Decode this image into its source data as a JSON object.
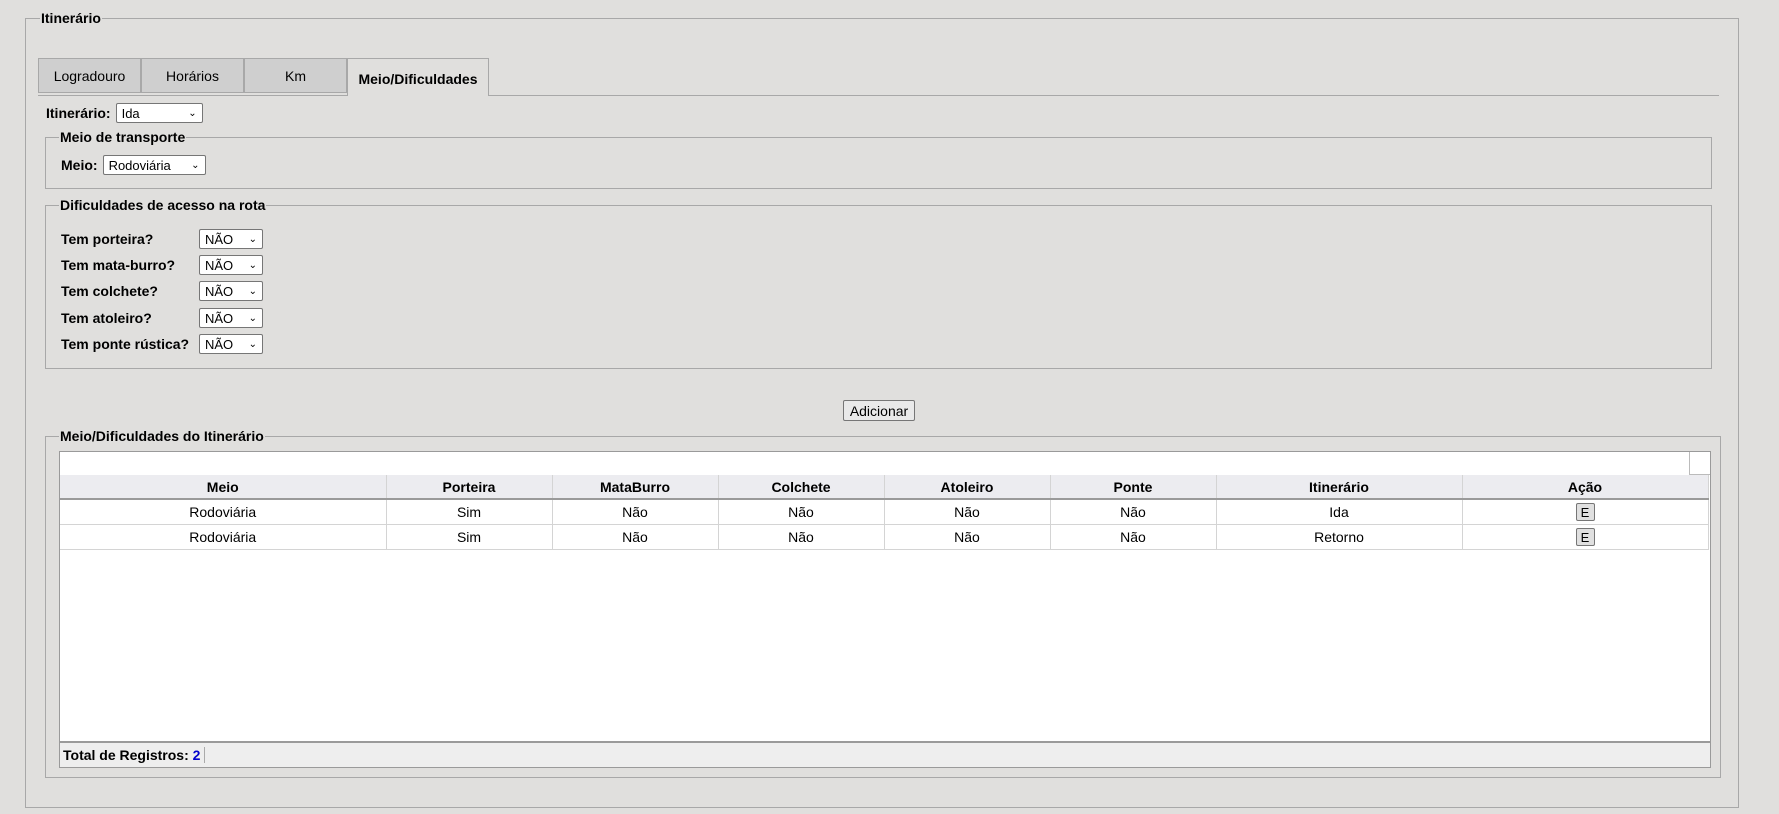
{
  "section_title": "Itinerário",
  "tabs": [
    "Logradouro",
    "Horários",
    "Km",
    "Meio/Dificuldades"
  ],
  "itinerario": {
    "label": "Itinerário:",
    "value": "Ida"
  },
  "meio_transporte": {
    "legend": "Meio de transporte",
    "label": "Meio:",
    "value": "Rodoviária"
  },
  "dificuldades": {
    "legend": "Dificuldades de acesso na rota",
    "items": [
      {
        "label": "Tem porteira?",
        "value": "NÃO"
      },
      {
        "label": "Tem mata-burro?",
        "value": "NÃO"
      },
      {
        "label": "Tem colchete?",
        "value": "NÃO"
      },
      {
        "label": "Tem atoleiro?",
        "value": "NÃO"
      },
      {
        "label": "Tem ponte rústica?",
        "value": "NÃO"
      }
    ]
  },
  "add_button": "Adicionar",
  "grid": {
    "legend": "Meio/Dificuldades do Itinerário",
    "columns": [
      "Meio",
      "Porteira",
      "MataBurro",
      "Colchete",
      "Atoleiro",
      "Ponte",
      "Itinerário",
      "Ação"
    ],
    "rows": [
      [
        "Rodoviária",
        "Sim",
        "Não",
        "Não",
        "Não",
        "Não",
        "Ida",
        "E"
      ],
      [
        "Rodoviária",
        "Sim",
        "Não",
        "Não",
        "Não",
        "Não",
        "Retorno",
        "E"
      ]
    ],
    "total_label": "Total de Registros:",
    "total_count": "2"
  }
}
